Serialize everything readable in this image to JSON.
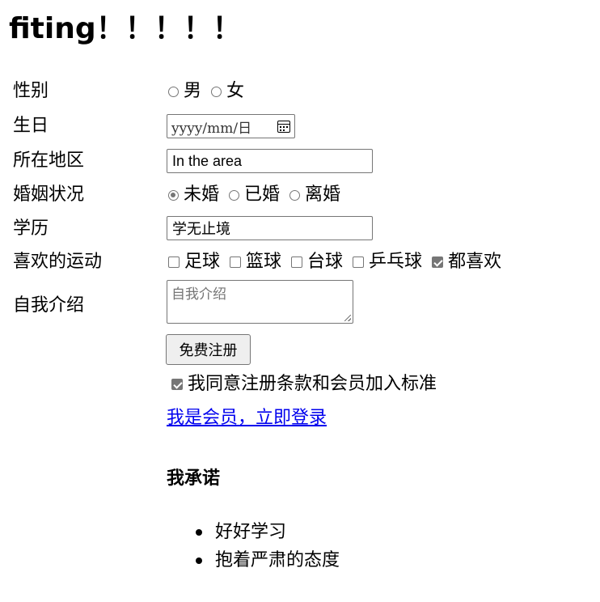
{
  "title": "fiting！！！！！",
  "form": {
    "gender": {
      "label": "性别",
      "options": [
        "男",
        "女"
      ]
    },
    "birthday": {
      "label": "生日",
      "placeholder": "yyyy/mm/日"
    },
    "region": {
      "label": "所在地区",
      "value": "In the area"
    },
    "marital": {
      "label": "婚姻状况",
      "options": [
        "未婚",
        "已婚",
        "离婚"
      ],
      "selected": "未婚"
    },
    "education": {
      "label": "学历",
      "value": "学无止境"
    },
    "sports": {
      "label": "喜欢的运动",
      "options": [
        "足球",
        "篮球",
        "台球",
        "乒乓球",
        "都喜欢"
      ],
      "checked": [
        "都喜欢"
      ]
    },
    "intro": {
      "label": "自我介绍",
      "placeholder": "自我介绍"
    },
    "submit_label": "免费注册",
    "agree": {
      "label": "我同意注册条款和会员加入标准",
      "checked": true
    },
    "login_link": "我是会员，立即登录"
  },
  "promise": {
    "heading": "我承诺",
    "items": [
      "好好学习",
      "抱着严肃的态度"
    ]
  },
  "colors": {
    "link": "#0000ee",
    "control_border": "#767676",
    "checked_fill": "#767676"
  }
}
